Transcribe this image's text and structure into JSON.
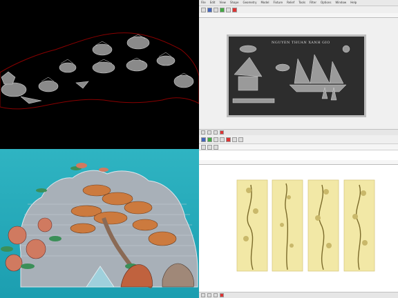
{
  "app": {
    "menu_items": [
      "File",
      "Edit",
      "View",
      "Shape",
      "Geometry",
      "Model",
      "Fixture",
      "Relief",
      "Tools",
      "Filter",
      "Options",
      "Window",
      "Help"
    ]
  },
  "panels": {
    "relief_title": "NGUYEN THUAN XANH GIO"
  },
  "colors": {
    "background_dark": "#000000",
    "relief_gray": "#9a9a9a",
    "boundary_red": "#8b0000",
    "teal_bg": "#22a9b9",
    "relief_yellow": "#f2e8a6",
    "relief_orange": "#cc7a3e"
  }
}
